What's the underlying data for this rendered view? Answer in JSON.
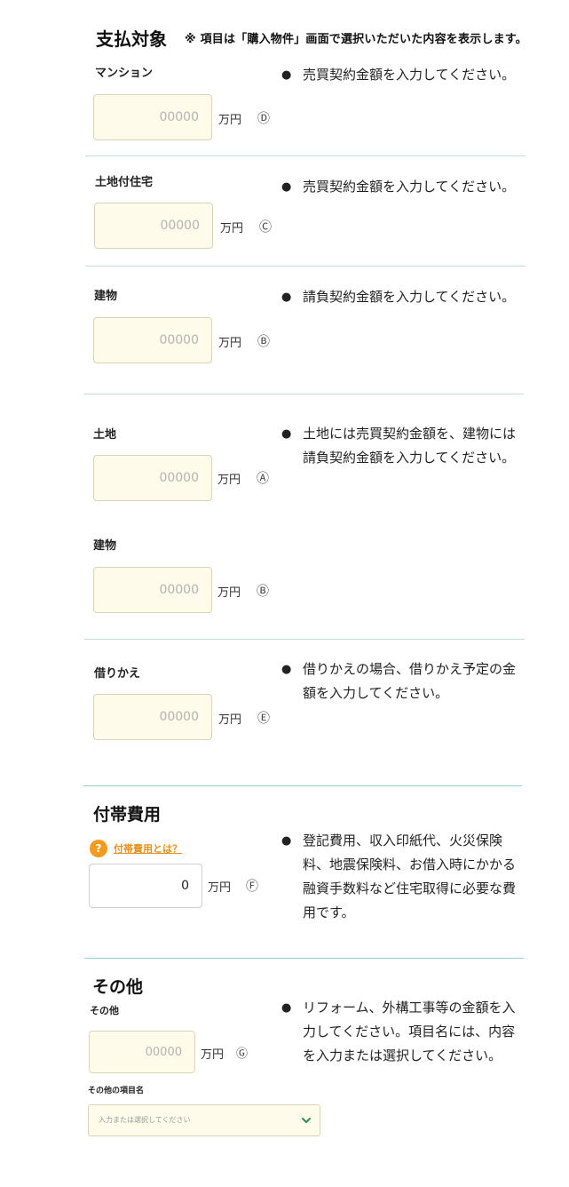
{
  "header": {
    "title": "支払対象",
    "note": "※ 項目は「購入物件」画面で選択いただいた内容を表示します。"
  },
  "placeholder": "00000",
  "unit": "万円",
  "rows": {
    "mansion": {
      "label": "マンション",
      "mark": "Ⓓ",
      "note": "売買契約金額を入力してください。"
    },
    "land_house": {
      "label": "土地付住宅",
      "mark": "Ⓒ",
      "note": "売買契約金額を入力してください。"
    },
    "building": {
      "label": "建物",
      "mark": "Ⓑ",
      "note": "請負契約金額を入力してください。"
    },
    "land": {
      "label": "土地",
      "mark": "Ⓐ",
      "note": "土地には売買契約金額を、建物には請負契約金額を入力してください。"
    },
    "building2": {
      "label": "建物",
      "mark": "Ⓑ"
    },
    "refinance": {
      "label": "借りかえ",
      "mark": "Ⓔ",
      "note": "借りかえの場合、借りかえ予定の金額を入力してください。"
    }
  },
  "incidental": {
    "title": "付帯費用",
    "help_icon": "?",
    "help_link": "付帯費用とは？",
    "value": "0",
    "mark": "Ⓕ",
    "note": "登記費用、収入印紙代、火災保険料、地震保険料、お借入時にかかる融資手数料など住宅取得に必要な費用です。"
  },
  "other": {
    "title": "その他",
    "label": "その他",
    "mark": "Ⓖ",
    "item_name_label": "その他の項目名",
    "select_placeholder": "入力または選択してください",
    "note": "リフォーム、外構工事等の金額を入力してください。項目名には、内容を入力または選択してください。"
  },
  "bullet": "●",
  "colors": {
    "accent": "#f39a1f",
    "input_bg": "#fffbea",
    "divider": "#bfe0d6",
    "chevron": "#2e8b57"
  }
}
